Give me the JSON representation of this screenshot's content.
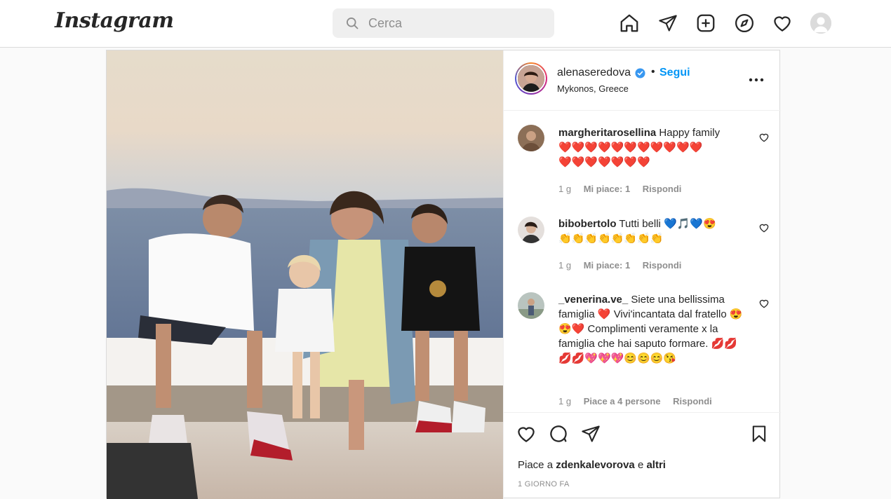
{
  "app": {
    "logo": "Instagram"
  },
  "search": {
    "placeholder": "Cerca"
  },
  "nav": {
    "icons": [
      "home-icon",
      "direct-icon",
      "new-post-icon",
      "explore-icon",
      "activity-heart-icon"
    ]
  },
  "post": {
    "author": {
      "username": "alenaseredova",
      "verified": true,
      "separator": "•",
      "follow_label": "Segui",
      "location": "Mykonos, Greece"
    },
    "comments": [
      {
        "username": "margheritarosellina",
        "text": "Happy family",
        "emoji_line1": "❤️❤️❤️❤️❤️❤️❤️❤️❤️❤️❤️",
        "emoji_line2": "❤️❤️❤️❤️❤️❤️❤️",
        "time": "1 g",
        "likes": "Mi piace: 1",
        "reply": "Rispondi"
      },
      {
        "username": "bibobertolo",
        "text": "Tutti belli",
        "emoji_line1": "💙🎵💙😍",
        "emoji_line2": "👏👏👏👏👏👏👏👏",
        "time": "1 g",
        "likes": "Mi piace: 1",
        "reply": "Rispondi"
      },
      {
        "username": "_venerina.ve_",
        "text": "Siete una bellissima famiglia ❤️ Vivi'incantata dal fratello 😍😍❤️ Complimenti veramente x la famiglia che hai saputo formare. 💋💋💋💋💖💖💖😊😊😊😘",
        "time": "1 g",
        "likes": "Piace a 4 persone",
        "reply": "Rispondi"
      }
    ],
    "likes_prefix": "Piace a",
    "likes_user": "zdenkalevorova",
    "likes_and": "e",
    "likes_others": "altri",
    "timestamp": "1 GIORNO FA"
  },
  "colors": {
    "accent": "#0095f6",
    "border": "#dbdbdb",
    "muted": "#8e8e8e",
    "text": "#262626"
  }
}
